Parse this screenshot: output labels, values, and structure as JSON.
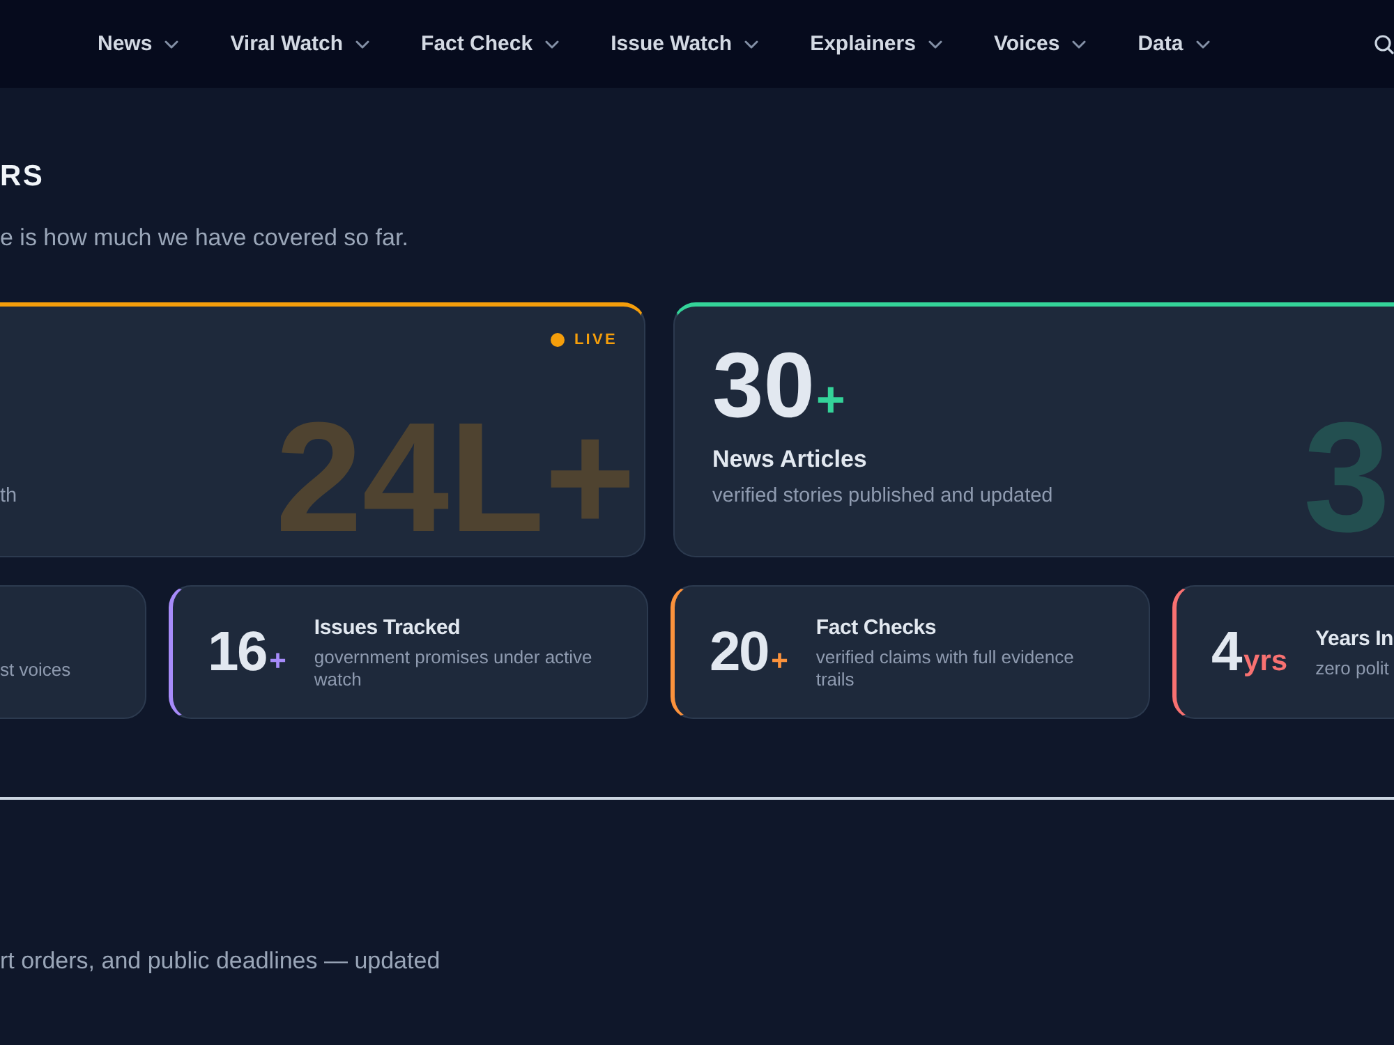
{
  "nav": {
    "items": [
      "News",
      "Viral Watch",
      "Fact Check",
      "Issue Watch",
      "Explainers",
      "Voices",
      "Data"
    ]
  },
  "stats_section": {
    "heading": "RS",
    "subtitle": "e is how much we have covered so far.",
    "featured": [
      {
        "color": "#f59e0b",
        "badge": "LIVE",
        "description": "th",
        "ghost": "24L+"
      },
      {
        "color": "#34d399",
        "value": "30",
        "suffix": "+",
        "title": "News Articles",
        "description": "verified stories published and updated",
        "ghost": "3"
      }
    ],
    "cards": [
      {
        "description": "st voices"
      },
      {
        "color": "#a78bfa",
        "value": "16",
        "suffix": "+",
        "title": "Issues Tracked",
        "description": "government promises under active watch"
      },
      {
        "color": "#fb923c",
        "value": "20",
        "suffix": "+",
        "title": "Fact Checks",
        "description": "verified claims with full evidence trails"
      },
      {
        "color": "#f87171",
        "value": "4",
        "suffix": "yrs",
        "title": "Years In",
        "description": "zero polit"
      }
    ]
  },
  "next_section": {
    "subtitle": "rt orders, and public deadlines — updated"
  }
}
